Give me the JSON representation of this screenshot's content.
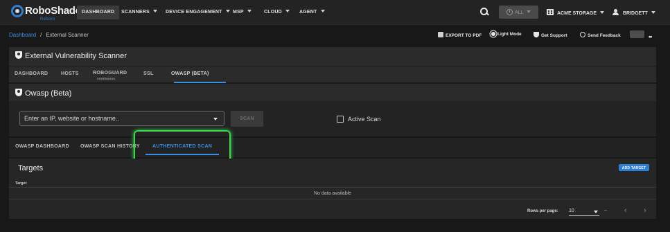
{
  "app": {
    "logo_text": "RoboShadow",
    "logo_sub": "Reborn",
    "nav": [
      {
        "label": "DASHBOARD"
      },
      {
        "label": "SCANNERS"
      },
      {
        "label": "DEVICE ENGAGEMENT"
      },
      {
        "label": "MSP"
      },
      {
        "label": "CLOUD"
      },
      {
        "label": "AGENT"
      }
    ],
    "history_select": "ALL",
    "org": "ACME STORAGE",
    "user": "BRIDGETT"
  },
  "breadcrumb": {
    "home": "Dashboard",
    "separator": "/",
    "current": "External Scanner"
  },
  "toolbar": {
    "export_pdf": "EXPORT TO PDF",
    "light_mode": "Light Mode",
    "get_support": "Get Support",
    "send_feedback": "Send Feedback"
  },
  "scanner": {
    "title": "External Vulnerability Scanner",
    "tabs": [
      {
        "label": "DASHBOARD"
      },
      {
        "label": "HOSTS"
      },
      {
        "label": "ROBOGUARD",
        "sub": "continuous"
      },
      {
        "label": "SSL"
      },
      {
        "label": "OWASP (BETA)"
      }
    ],
    "active_tab": "OWASP (BETA)"
  },
  "owasp": {
    "title": "Owasp (Beta)",
    "target_placeholder": "Enter an IP, website or hostname..",
    "scan_button": "SCAN",
    "active_scan_label": "Active Scan",
    "active_scan_checked": false,
    "tabs": [
      {
        "label": "OWASP DASHBOARD"
      },
      {
        "label": "OWASP SCAN HISTORY"
      },
      {
        "label": "AUTHENTICATED SCAN"
      }
    ],
    "active_tab": "AUTHENTICATED SCAN"
  },
  "targets": {
    "title": "Targets",
    "add_button": "ADD TARGET",
    "columns": [
      "Target"
    ],
    "empty_text": "No data available",
    "rows_per_page_label": "Rows per page:",
    "rows_per_page": "10",
    "range": "–"
  },
  "colors": {
    "accent": "#3a8ee6",
    "highlight": "#39d94a",
    "background": "#181818"
  }
}
